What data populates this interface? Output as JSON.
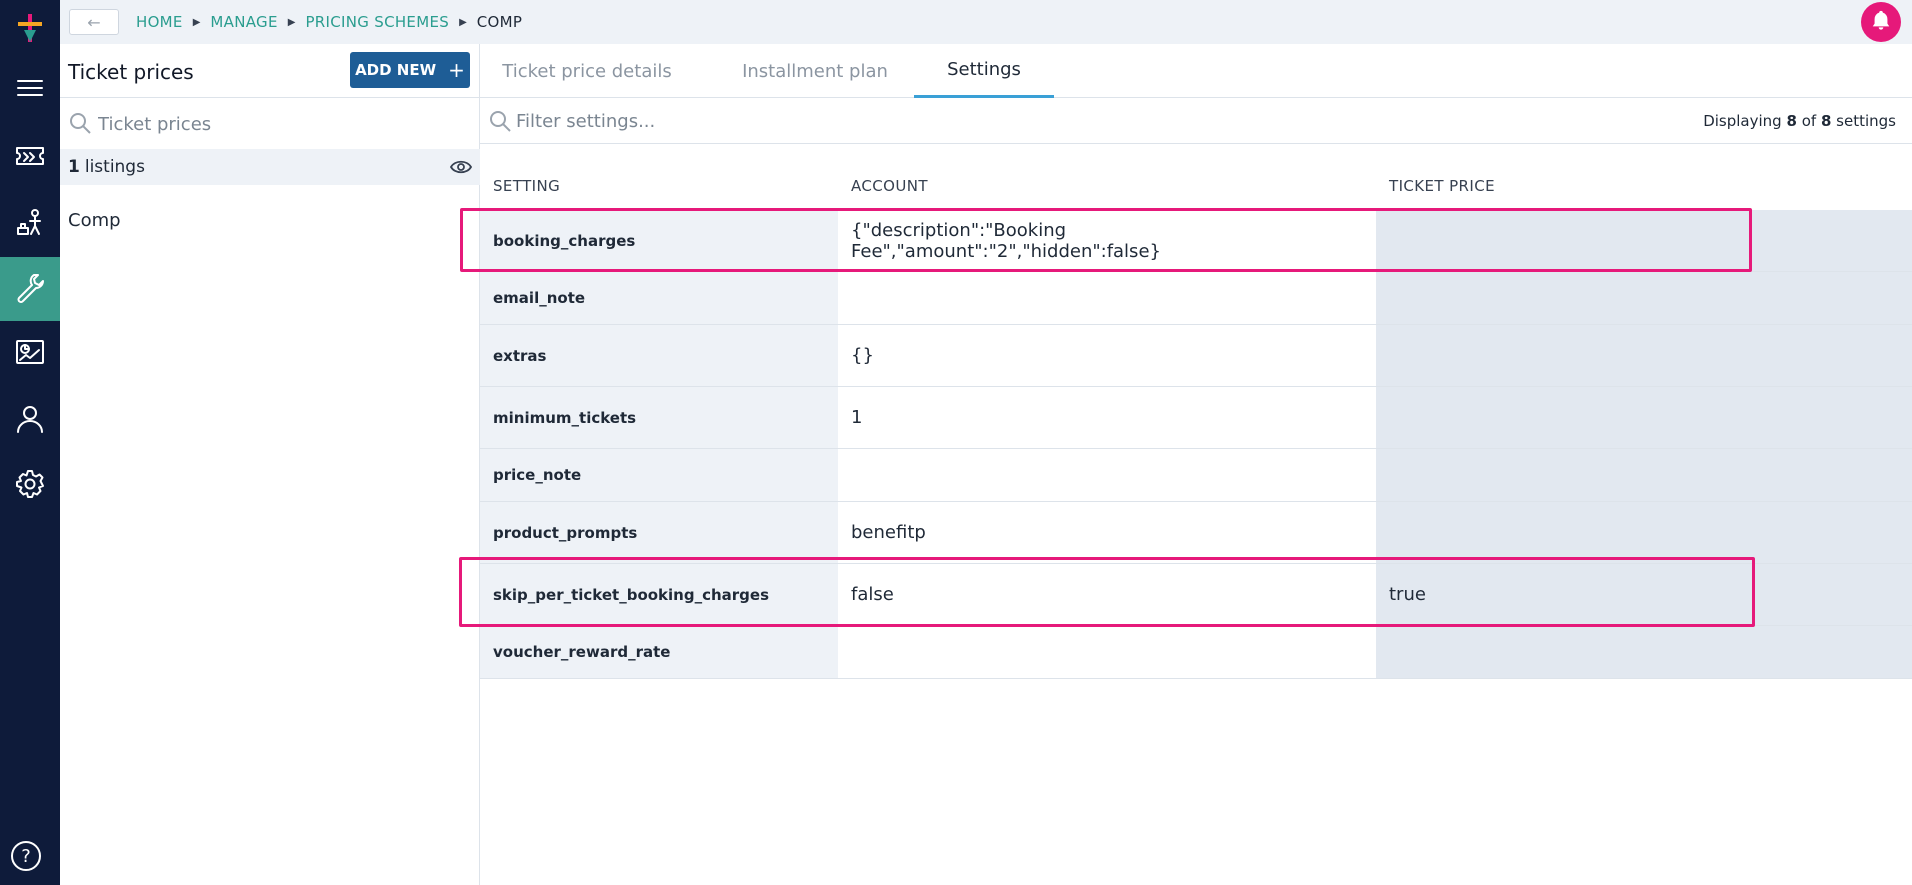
{
  "topbar": {
    "back_label": "←",
    "breadcrumbs": [
      "HOME",
      "MANAGE",
      "PRICING SCHEMES",
      "COMP"
    ]
  },
  "rail": {
    "icons": [
      "menu-icon",
      "ticket-icon",
      "people-icon",
      "wrench-icon",
      "report-icon",
      "user-icon",
      "gear-icon"
    ],
    "active": "wrench-icon",
    "help_label": "?"
  },
  "listpanel": {
    "title": "Ticket prices",
    "add_label": "ADD NEW",
    "add_plus": "+",
    "search_placeholder": "Ticket prices",
    "count_num": "1",
    "count_label": "listings",
    "items": [
      "Comp"
    ]
  },
  "tabs": [
    {
      "label": "Ticket price details",
      "active": false
    },
    {
      "label": "Installment plan",
      "active": false
    },
    {
      "label": "Settings",
      "active": true
    }
  ],
  "filter": {
    "placeholder": "Filter settings...",
    "disp_prefix": "Displaying",
    "disp_shown": "8",
    "disp_of": "of",
    "disp_total": "8",
    "disp_suffix": "settings"
  },
  "table": {
    "headers": [
      "SETTING",
      "ACCOUNT",
      "TICKET PRICE"
    ],
    "rows": [
      {
        "setting": "booking_charges",
        "account": "{\"description\":\"Booking Fee\",\"amount\":\"2\",\"hidden\":false}",
        "ticket_price": ""
      },
      {
        "setting": "email_note",
        "account": "",
        "ticket_price": ""
      },
      {
        "setting": "extras",
        "account": "{}",
        "ticket_price": ""
      },
      {
        "setting": "minimum_tickets",
        "account": "1",
        "ticket_price": ""
      },
      {
        "setting": "price_note",
        "account": "",
        "ticket_price": ""
      },
      {
        "setting": "product_prompts",
        "account": "benefitp",
        "ticket_price": ""
      },
      {
        "setting": "skip_per_ticket_booking_charges",
        "account": "false",
        "ticket_price": "true"
      },
      {
        "setting": "voucher_reward_rate",
        "account": "",
        "ticket_price": ""
      }
    ],
    "highlighted_rows": [
      "booking_charges",
      "skip_per_ticket_booking_charges"
    ]
  },
  "colors": {
    "rail": "#0e1b3a",
    "rail_active": "#3a9b8b",
    "breadcrumb": "#2a9d8f",
    "primary_button": "#1e5d96",
    "tab_underline": "#3aa0d6",
    "highlight": "#e6197a",
    "notification": "#e6197a"
  }
}
